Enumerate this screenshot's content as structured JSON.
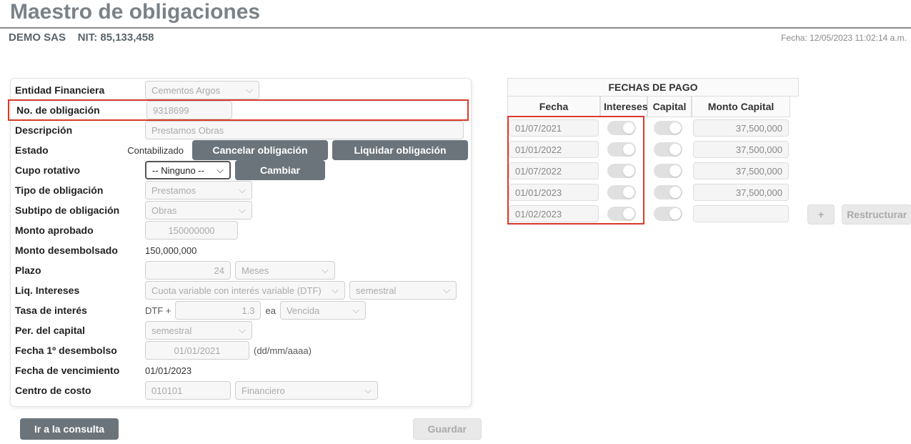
{
  "header": {
    "title": "Maestro de obligaciones",
    "company": "DEMO SAS",
    "nit_label": "NIT:",
    "nit_value": "85,133,458",
    "datetime_label": "Fecha:",
    "datetime_value": "12/05/2023 11:02:14 a.m."
  },
  "form": {
    "entidad": {
      "label": "Entidad Financiera",
      "value": "Cementos Argos"
    },
    "no_obligacion": {
      "label": "No. de obligación",
      "value": "9318699"
    },
    "descripcion": {
      "label": "Descripción",
      "value": "Prestamos Obras"
    },
    "estado": {
      "label": "Estado",
      "value": "Contabilizado",
      "cancel": "Cancelar obligación",
      "liquidar": "Liquidar obligación"
    },
    "cupo": {
      "label": "Cupo rotativo",
      "value": "-- Ninguno --",
      "change": "Cambiar"
    },
    "tipo": {
      "label": "Tipo de obligación",
      "value": "Prestamos"
    },
    "subtipo": {
      "label": "Subtipo de obligación",
      "value": "Obras"
    },
    "monto_aprobado": {
      "label": "Monto aprobado",
      "value": "150000000"
    },
    "monto_desembolsado": {
      "label": "Monto desembolsado",
      "value": "150,000,000"
    },
    "plazo": {
      "label": "Plazo",
      "value": "24",
      "unit": "Meses"
    },
    "liq_intereses": {
      "label": "Liq. Intereses",
      "formula": "Cuota variable con interés variable (DTF)",
      "period": "semestral"
    },
    "tasa": {
      "label": "Tasa de interés",
      "prefix": "DTF +",
      "value": "1.3",
      "ea": "ea",
      "tipo": "Vencida"
    },
    "per_capital": {
      "label": "Per. del capital",
      "value": "semestral"
    },
    "fecha_desembolso": {
      "label": "Fecha 1º desembolso",
      "value": "01/01/2021",
      "hint": "(dd/mm/aaaa)"
    },
    "fecha_vencimiento": {
      "label": "Fecha de vencimiento",
      "value": "01/01/2023"
    },
    "centro_costo": {
      "label": "Centro de costo",
      "code": "010101",
      "name": "Financiero"
    }
  },
  "footer": {
    "consulta": "Ir a la consulta",
    "guardar": "Guardar"
  },
  "payments": {
    "title": "FECHAS DE PAGO",
    "cols": {
      "fecha": "Fecha",
      "intereses": "Intereses",
      "capital": "Capital",
      "monto": "Monto Capital"
    },
    "rows": [
      {
        "fecha": "01/07/2021",
        "monto": "37,500,000"
      },
      {
        "fecha": "01/01/2022",
        "monto": "37,500,000"
      },
      {
        "fecha": "01/07/2022",
        "monto": "37,500,000"
      },
      {
        "fecha": "01/01/2023",
        "monto": "37,500,000"
      },
      {
        "fecha": "01/02/2023",
        "monto": ""
      }
    ],
    "add": "+",
    "restructurar": "Restructurar"
  }
}
